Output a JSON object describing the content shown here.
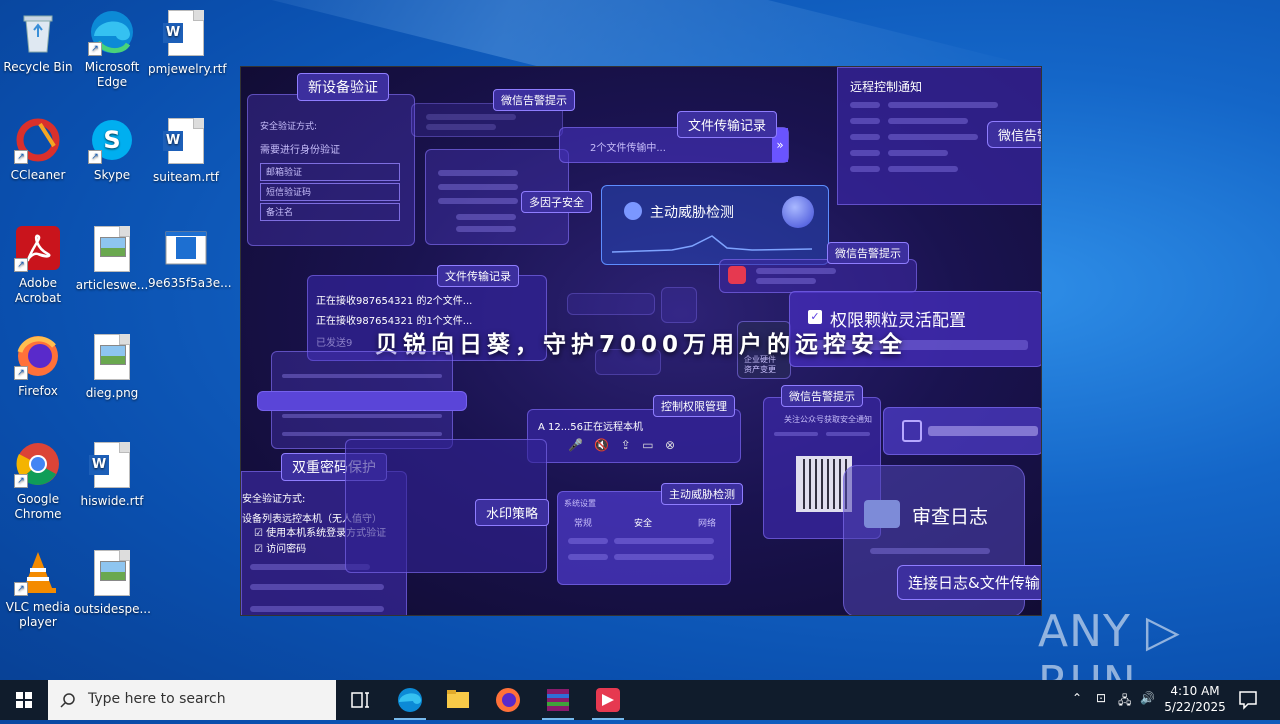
{
  "desktop": {
    "icons": [
      {
        "label": "Recycle Bin"
      },
      {
        "label": "Microsoft Edge"
      },
      {
        "label": "pmjewelry.rtf"
      },
      {
        "label": "CCleaner"
      },
      {
        "label": "Skype"
      },
      {
        "label": "suiteam.rtf"
      },
      {
        "label": "Adobe Acrobat"
      },
      {
        "label": "articleswe..."
      },
      {
        "label": "9e635f5a3e..."
      },
      {
        "label": "Firefox"
      },
      {
        "label": "dieg.png"
      },
      {
        "label": "Google Chrome"
      },
      {
        "label": "hiswide.rtf"
      },
      {
        "label": "VLC media player"
      },
      {
        "label": "outsidespe..."
      }
    ]
  },
  "app": {
    "slogan": "贝锐向日葵，守护7000万用户的远控安全",
    "cards": {
      "new_device": {
        "tag": "新设备验证",
        "l1": "安全验证方式:",
        "l2": "需要进行身份验证",
        "opt1": "邮箱验证",
        "opt2": "短信验证码",
        "opt3": "备注名"
      },
      "wechat_alert_top": "微信告警提示",
      "file_transfer_top": {
        "tag": "文件传输记录",
        "text": "2个文件传输中..."
      },
      "multi_factor": "多因子安全",
      "threat_detect": "主动威胁检测",
      "remote_notify": {
        "title": "远程控制通知",
        "tag": "微信告警"
      },
      "file_transfer_mid": {
        "tag": "文件传输记录",
        "l1": "正在接收987654321 的2个文件...",
        "l2": "正在接收987654321 的1个文件...",
        "l3": "已发送9"
      },
      "wechat_alert_mid": "微信告警提示",
      "perm_config": "权限颗粒灵活配置",
      "enterprise": {
        "l1": "企业硬件",
        "l2": "资产变更"
      },
      "control_perm": {
        "tag": "控制权限管理",
        "text": "A 12...56正在远程本机"
      },
      "wechat_alert_qr": {
        "tag": "微信告警提示",
        "l1": "关注公众号获取安全通知"
      },
      "dual_password": {
        "tag": "双重密码保护",
        "l1": "安全验证方式:",
        "l2": "设备列表远控本机（无人值守）",
        "c1": "使用本机系统登录方式验证",
        "c2": "访问密码"
      },
      "watermark": "水印策略",
      "threat_detect2": {
        "tag": "主动威胁检测",
        "sys": "系统设置",
        "t1": "常规",
        "t2": "安全",
        "t3": "网络"
      },
      "audit": "审查日志",
      "conn_log": "连接日志&文件传输"
    }
  },
  "taskbar": {
    "search_placeholder": "Type here to search",
    "time": "4:10 AM",
    "date": "5/22/2025"
  },
  "watermark": "ANY ▷ RUN"
}
